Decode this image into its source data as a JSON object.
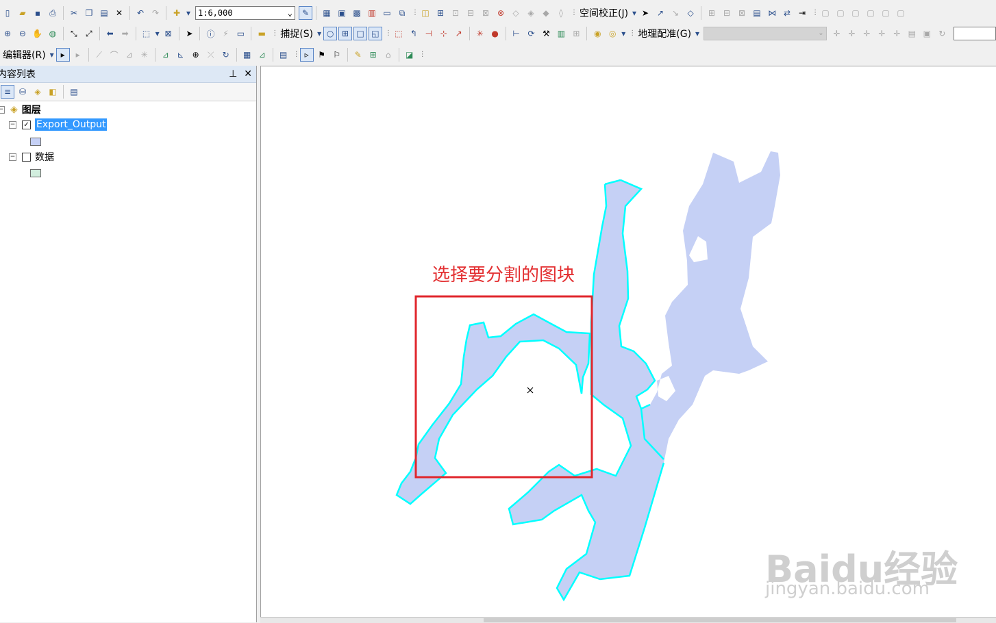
{
  "toolbar1": {
    "scale_value": "1:6,000",
    "spatial_adjust_label": "空间校正(J)"
  },
  "toolbar2": {
    "snap_label": "捕捉(S)",
    "georef_label": "地理配准(G)"
  },
  "toolbar3": {
    "editor_label": "编辑器(R)"
  },
  "toc": {
    "title": "内容列表",
    "root_label": "图层",
    "layers": [
      {
        "name": "Export_Output",
        "checked": true,
        "selected": true,
        "swatch_color": "#c5d0f5"
      },
      {
        "name": "数据",
        "checked": false,
        "selected": false,
        "swatch_color": "#d2eede"
      }
    ]
  },
  "map": {
    "annotation": "选择要分割的图块",
    "annotation_color": "#e32f31",
    "polygon_fill": "#c5d0f5",
    "polygon_outline": "#00ffff",
    "selection_rect_color": "#e0262c",
    "watermark": "Baidu经验",
    "watermark_url": "jingyan.baidu.com"
  },
  "icons": [
    "new-icon",
    "open-icon",
    "save-icon",
    "print-icon",
    "cut-icon",
    "copy-icon",
    "paste-icon",
    "delete-icon",
    "undo-icon",
    "redo-icon",
    "add-data-icon",
    "zoom-in-icon",
    "zoom-out-icon",
    "pan-icon",
    "globe-icon",
    "select-icon",
    "identify-icon",
    "pin-icon",
    "close-icon"
  ]
}
